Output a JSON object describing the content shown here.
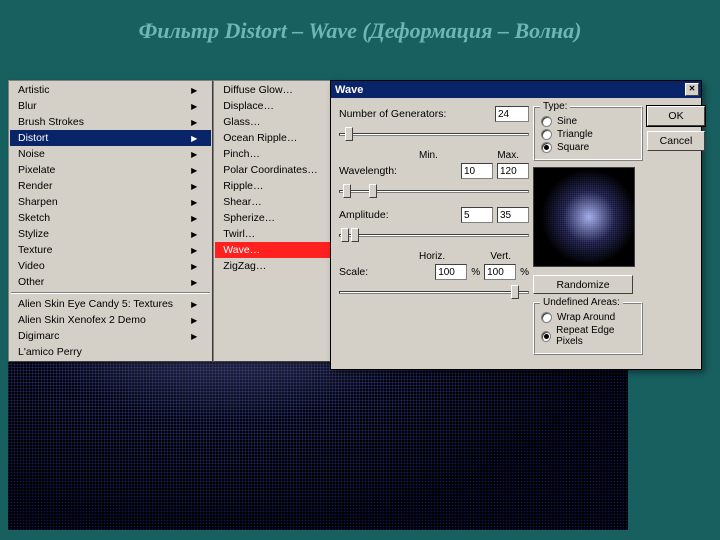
{
  "slide": {
    "title": "Фильтр Distort – Wave (Деформация – Волна)"
  },
  "menu": {
    "items": [
      {
        "label": "Artistic",
        "submenu": true
      },
      {
        "label": "Blur",
        "submenu": true
      },
      {
        "label": "Brush Strokes",
        "submenu": true
      },
      {
        "label": "Distort",
        "submenu": true,
        "selected": true
      },
      {
        "label": "Noise",
        "submenu": true
      },
      {
        "label": "Pixelate",
        "submenu": true
      },
      {
        "label": "Render",
        "submenu": true
      },
      {
        "label": "Sharpen",
        "submenu": true
      },
      {
        "label": "Sketch",
        "submenu": true
      },
      {
        "label": "Stylize",
        "submenu": true
      },
      {
        "label": "Texture",
        "submenu": true
      },
      {
        "label": "Video",
        "submenu": true
      },
      {
        "label": "Other",
        "submenu": true
      }
    ],
    "plugins": [
      {
        "label": "Alien Skin Eye Candy 5: Textures",
        "submenu": true
      },
      {
        "label": "Alien Skin Xenofex 2 Demo",
        "submenu": true
      },
      {
        "label": "Digimarc",
        "submenu": true
      },
      {
        "label": "L'amico Perry",
        "submenu": true
      }
    ],
    "distort": [
      "Diffuse Glow…",
      "Displace…",
      "Glass…",
      "Ocean Ripple…",
      "Pinch…",
      "Polar Coordinates…",
      "Ripple…",
      "Shear…",
      "Spherize…",
      "Twirl…",
      "Wave…",
      "ZigZag…"
    ],
    "highlight": "Wave…"
  },
  "dialog": {
    "title": "Wave",
    "generators_label": "Number of Generators:",
    "generators": "24",
    "min_label": "Min.",
    "max_label": "Max.",
    "wavelength_label": "Wavelength:",
    "wavelength_min": "10",
    "wavelength_max": "120",
    "amplitude_label": "Amplitude:",
    "amplitude_min": "5",
    "amplitude_max": "35",
    "horiz_label": "Horiz.",
    "vert_label": "Vert.",
    "scale_label": "Scale:",
    "scale_h": "100",
    "scale_v": "100",
    "pct": "%",
    "type": {
      "title": "Type:",
      "options": [
        "Sine",
        "Triangle",
        "Square"
      ],
      "selected": "Square"
    },
    "undefined": {
      "title": "Undefined Areas:",
      "options": [
        "Wrap Around",
        "Repeat Edge Pixels"
      ],
      "selected": "Repeat Edge Pixels"
    },
    "ok": "OK",
    "cancel": "Cancel",
    "randomize": "Randomize"
  }
}
